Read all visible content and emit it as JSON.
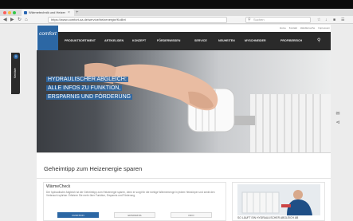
{
  "browser": {
    "tab_title": "Wärmetechnik und Heizenergie...",
    "tab_close": "×",
    "new_tab": "+",
    "url": "https://www.comfort-sa.de/service/heizenergie/Kolibri",
    "search_placeholder": "Suchen",
    "nav_icons": {
      "back": "back-arrow-icon",
      "forward": "forward-arrow-icon",
      "reload": "reload-icon"
    }
  },
  "site": {
    "logo": "comfort",
    "utility_links": [
      "Home",
      "Kontakt",
      "Händlersuche",
      "Impressum"
    ],
    "nav": [
      "PRODUKTSORTIMENT",
      "ARTIKELIDEN",
      "KONZEPT",
      "FÖRDERWISSEN",
      "SERVICE",
      "NEUHEITEN",
      "MYSCHNEIDER",
      "PROFIBEREICH"
    ],
    "hero_headline": [
      "HYDRAULISCHER ABGLEICH:",
      "ALLE INFOS ZU FUNKTION,",
      "ERSPARNIS UND FÖRDERUNG"
    ],
    "side_tab": {
      "label": "Merkliste",
      "count": "0"
    },
    "section_title": "Geheimtipp zum Heizenergie sparen",
    "card": {
      "title": "WärmeCheck",
      "description": "Der hydraulische Abgleich ist der Geheimtipp zum Heizenergie sparen, denn er sorgt für die richtige Wärmemenge in jedem Heizkörper und senkt den Verbrauch spürbar. Erfahren Sie mehr über Funktion, Ersparnis und Förderung.",
      "tabs": [
        "FUNKTION",
        "ERSPARNIS",
        "INFO"
      ]
    },
    "promo_title": "SO LÄUFT EIN HYDRAULISCHER ABGLEICH AB"
  },
  "colors": {
    "brand": "#2c67a4",
    "nav_bg": "#2a2a2a",
    "tab_active": "#2c67a4"
  }
}
